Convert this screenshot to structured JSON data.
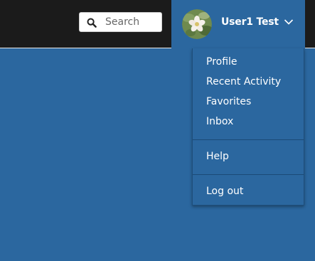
{
  "header": {
    "search": {
      "placeholder": "Search",
      "value": ""
    },
    "user": {
      "name": "User1 Test"
    }
  },
  "user_menu": {
    "groups": [
      [
        "Profile",
        "Recent Activity",
        "Favorites",
        "Inbox"
      ],
      [
        "Help"
      ],
      [
        "Log out"
      ]
    ]
  },
  "colors": {
    "header_bg": "#1b1b1b",
    "accent": "#2b679f",
    "text": "#ffffff"
  }
}
